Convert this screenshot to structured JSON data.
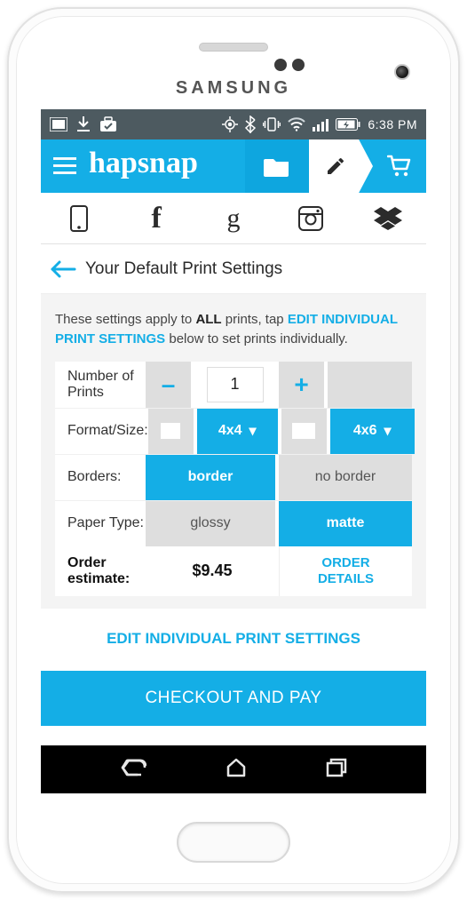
{
  "device": {
    "brand": "SAMSUNG"
  },
  "statusbar": {
    "time": "6:38 PM"
  },
  "header": {
    "logo": "hapsnap"
  },
  "sources": {
    "google_glyph": "g",
    "facebook_glyph": "f"
  },
  "page": {
    "title": "Your Default Print Settings",
    "intro_pre": "These settings apply to ",
    "intro_bold": "ALL",
    "intro_mid": " prints, tap ",
    "intro_link": "EDIT INDIVIDUAL PRINT SETTINGS",
    "intro_post": " below to set prints individually."
  },
  "settings": {
    "number_label": "Number of Prints",
    "number_value": "1",
    "minus": "–",
    "plus": "+",
    "format_label": "Format/Size:",
    "format_opt1": "4x4",
    "format_opt2": "4x6",
    "borders_label": "Borders:",
    "borders_opt1": "border",
    "borders_opt2": "no border",
    "paper_label": "Paper Type:",
    "paper_opt1": "glossy",
    "paper_opt2": "matte",
    "order_label": "Order estimate:",
    "order_price": "$9.45",
    "order_details": "ORDER DETAILS"
  },
  "links": {
    "edit_individual": "EDIT INDIVIDUAL PRINT SETTINGS"
  },
  "buttons": {
    "checkout": "CHECKOUT AND PAY"
  }
}
